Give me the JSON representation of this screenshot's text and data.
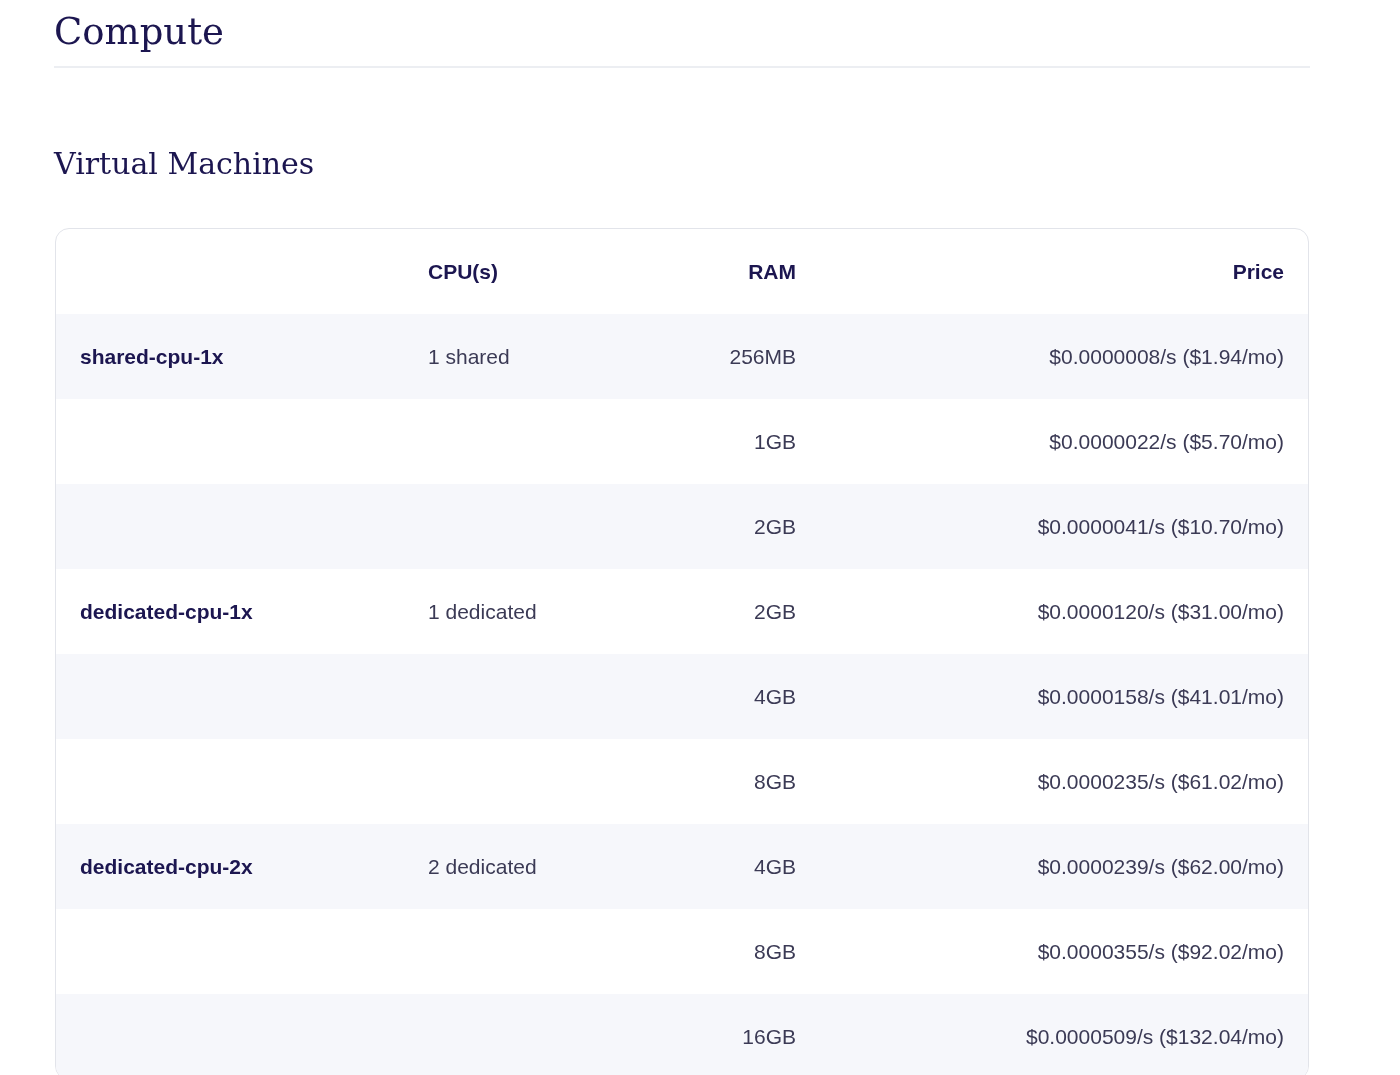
{
  "title": "Compute",
  "section": {
    "title": "Virtual Machines",
    "table": {
      "columns": [
        {
          "label": "CPU(s)"
        },
        {
          "label": "RAM"
        },
        {
          "label": "Price"
        }
      ],
      "rows": [
        {
          "name": "shared-cpu-1x",
          "cpu": "1 shared",
          "ram": "256MB",
          "price": "$0.0000008/s ($1.94/mo)"
        },
        {
          "ram": "1GB",
          "price": "$0.0000022/s ($5.70/mo)"
        },
        {
          "ram": "2GB",
          "price": "$0.0000041/s ($10.70/mo)"
        },
        {
          "name": "dedicated-cpu-1x",
          "cpu": "1 dedicated",
          "ram": "2GB",
          "price": "$0.0000120/s ($31.00/mo)"
        },
        {
          "ram": "4GB",
          "price": "$0.0000158/s ($41.01/mo)"
        },
        {
          "ram": "8GB",
          "price": "$0.0000235/s ($61.02/mo)"
        },
        {
          "name": "dedicated-cpu-2x",
          "cpu": "2 dedicated",
          "ram": "4GB",
          "price": "$0.0000239/s ($62.00/mo)"
        },
        {
          "ram": "8GB",
          "price": "$0.0000355/s ($92.02/mo)"
        },
        {
          "ram": "16GB",
          "price": "$0.0000509/s ($132.04/mo)"
        }
      ]
    }
  }
}
